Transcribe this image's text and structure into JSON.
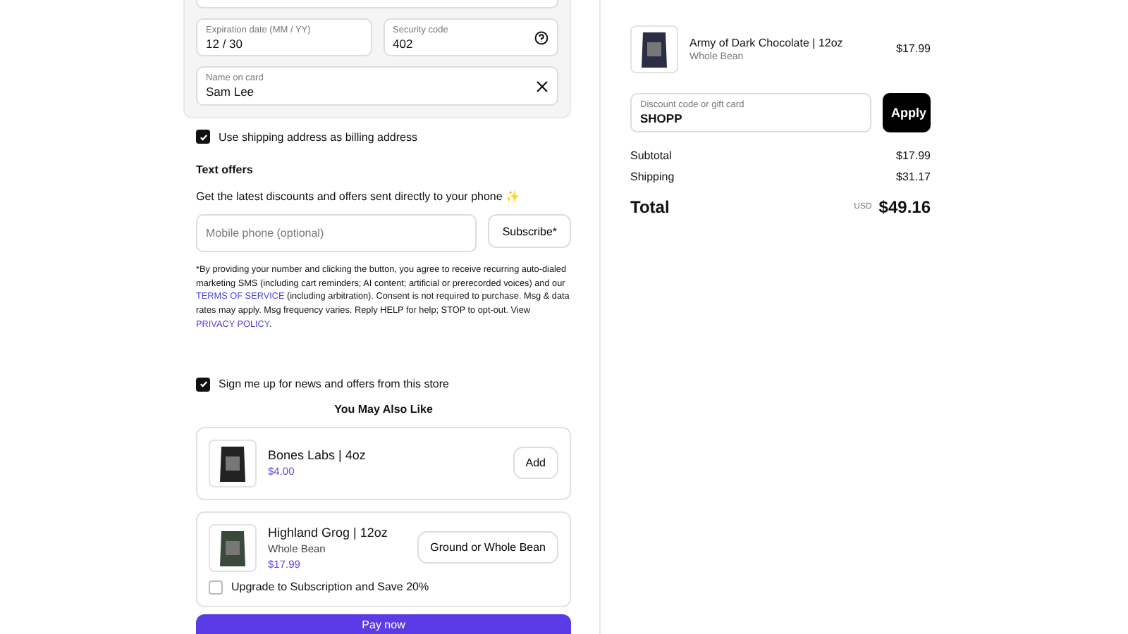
{
  "payment": {
    "expiration": {
      "placeholder": "Expiration date (MM / YY)",
      "value": "12 / 30"
    },
    "security": {
      "placeholder": "Security code",
      "value": "402"
    },
    "name": {
      "placeholder": "Name on card",
      "value": "Sam Lee"
    }
  },
  "billing_same": {
    "label": "Use shipping address as billing address",
    "checked": true
  },
  "text_offers": {
    "title": "Text offers",
    "description": "Get the latest discounts and offers sent directly to your phone ✨",
    "phone": {
      "placeholder": "Mobile phone (optional)"
    },
    "subscribe": "Subscribe*",
    "disclaimer": [
      "*By providing your number and clicking the button, you agree to receive recurring auto-dialed marketing SMS (including cart reminders; AI content; artificial or prerecorded voices) and our ",
      {
        "link": "TERMS OF SERVICE"
      },
      " (including arbitration). Consent is not required to purchase. Msg & data rates may apply. Msg frequency varies. Reply HELP for help; STOP to opt-out. View ",
      {
        "link": "PRIVACY POLICY"
      },
      "."
    ]
  },
  "newsletter": {
    "label": "Sign me up for news and offers from this store",
    "checked": true
  },
  "upsell": {
    "title": "You May Also Like",
    "items": [
      {
        "name": "Bones Labs | 4oz",
        "price": "$4.00",
        "button": "Add"
      },
      {
        "name": "Highland Grog | 12oz",
        "variant": "Whole Bean",
        "price": "$17.99",
        "button": "Ground or Whole Bean",
        "subscription": {
          "label": "Upgrade to Subscription and Save 20%",
          "checked": false
        }
      }
    ]
  },
  "pay_button": "Pay now",
  "summary": {
    "items": [
      {
        "name": "Army of Dark Chocolate | 12oz",
        "variant": "Whole Bean",
        "price": "$17.99"
      }
    ],
    "discount": {
      "placeholder": "Discount code or gift card",
      "value": "SHOPP",
      "button": "Apply"
    },
    "subtotal": {
      "label": "Subtotal",
      "value": "$17.99"
    },
    "shipping": {
      "label": "Shipping",
      "value": "$31.17"
    },
    "total": {
      "label": "Total",
      "currency": "USD",
      "value": "$49.16"
    }
  }
}
